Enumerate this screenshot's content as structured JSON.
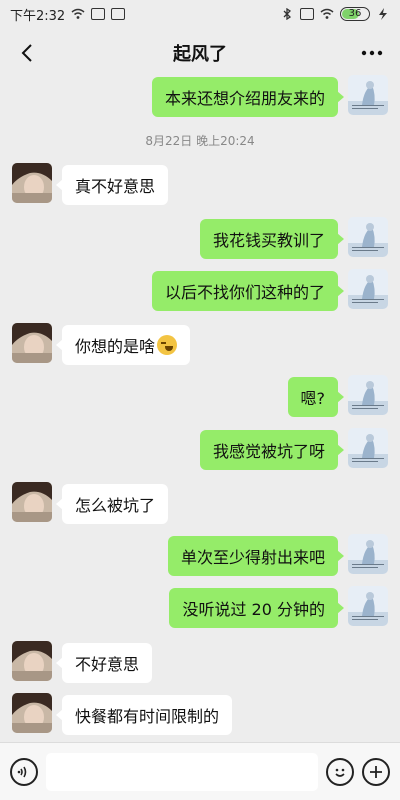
{
  "status_bar": {
    "time": "下午2:32",
    "battery_level": "36",
    "icons": [
      "wifi-icon",
      "cloud-icon",
      "notification-icon",
      "bluetooth-icon",
      "sim-off-icon",
      "wifi-icon",
      "bolt-icon"
    ]
  },
  "header": {
    "title": "起风了",
    "back_icon": "chevron-left-icon",
    "more_icon": "more-icon"
  },
  "timestamp": "8月22日 晚上20:24",
  "messages": [
    {
      "sender": "me",
      "text": "本来还想介绍朋友来的"
    },
    {
      "sender": "other",
      "text": "真不好意思"
    },
    {
      "sender": "me",
      "text": "我花钱买教训了"
    },
    {
      "sender": "me",
      "text": "以后不找你们这种的了"
    },
    {
      "sender": "other",
      "text": "你想的是啥",
      "emoji": "laugh-cry-emoji"
    },
    {
      "sender": "me",
      "text": "嗯?"
    },
    {
      "sender": "me",
      "text": "我感觉被坑了呀"
    },
    {
      "sender": "other",
      "text": "怎么被坑了"
    },
    {
      "sender": "me",
      "text": "单次至少得射出来吧"
    },
    {
      "sender": "me",
      "text": "没听说过 20 分钟的"
    },
    {
      "sender": "other",
      "text": "不好意思"
    },
    {
      "sender": "other",
      "text": "快餐都有时间限制的"
    }
  ],
  "input_bar": {
    "voice_icon": "voice-icon",
    "emoji_icon": "emoji-icon",
    "plus_icon": "plus-icon",
    "input_value": ""
  },
  "colors": {
    "my_bubble": "#95ec69",
    "other_bubble": "#ffffff",
    "background": "#ededed"
  }
}
